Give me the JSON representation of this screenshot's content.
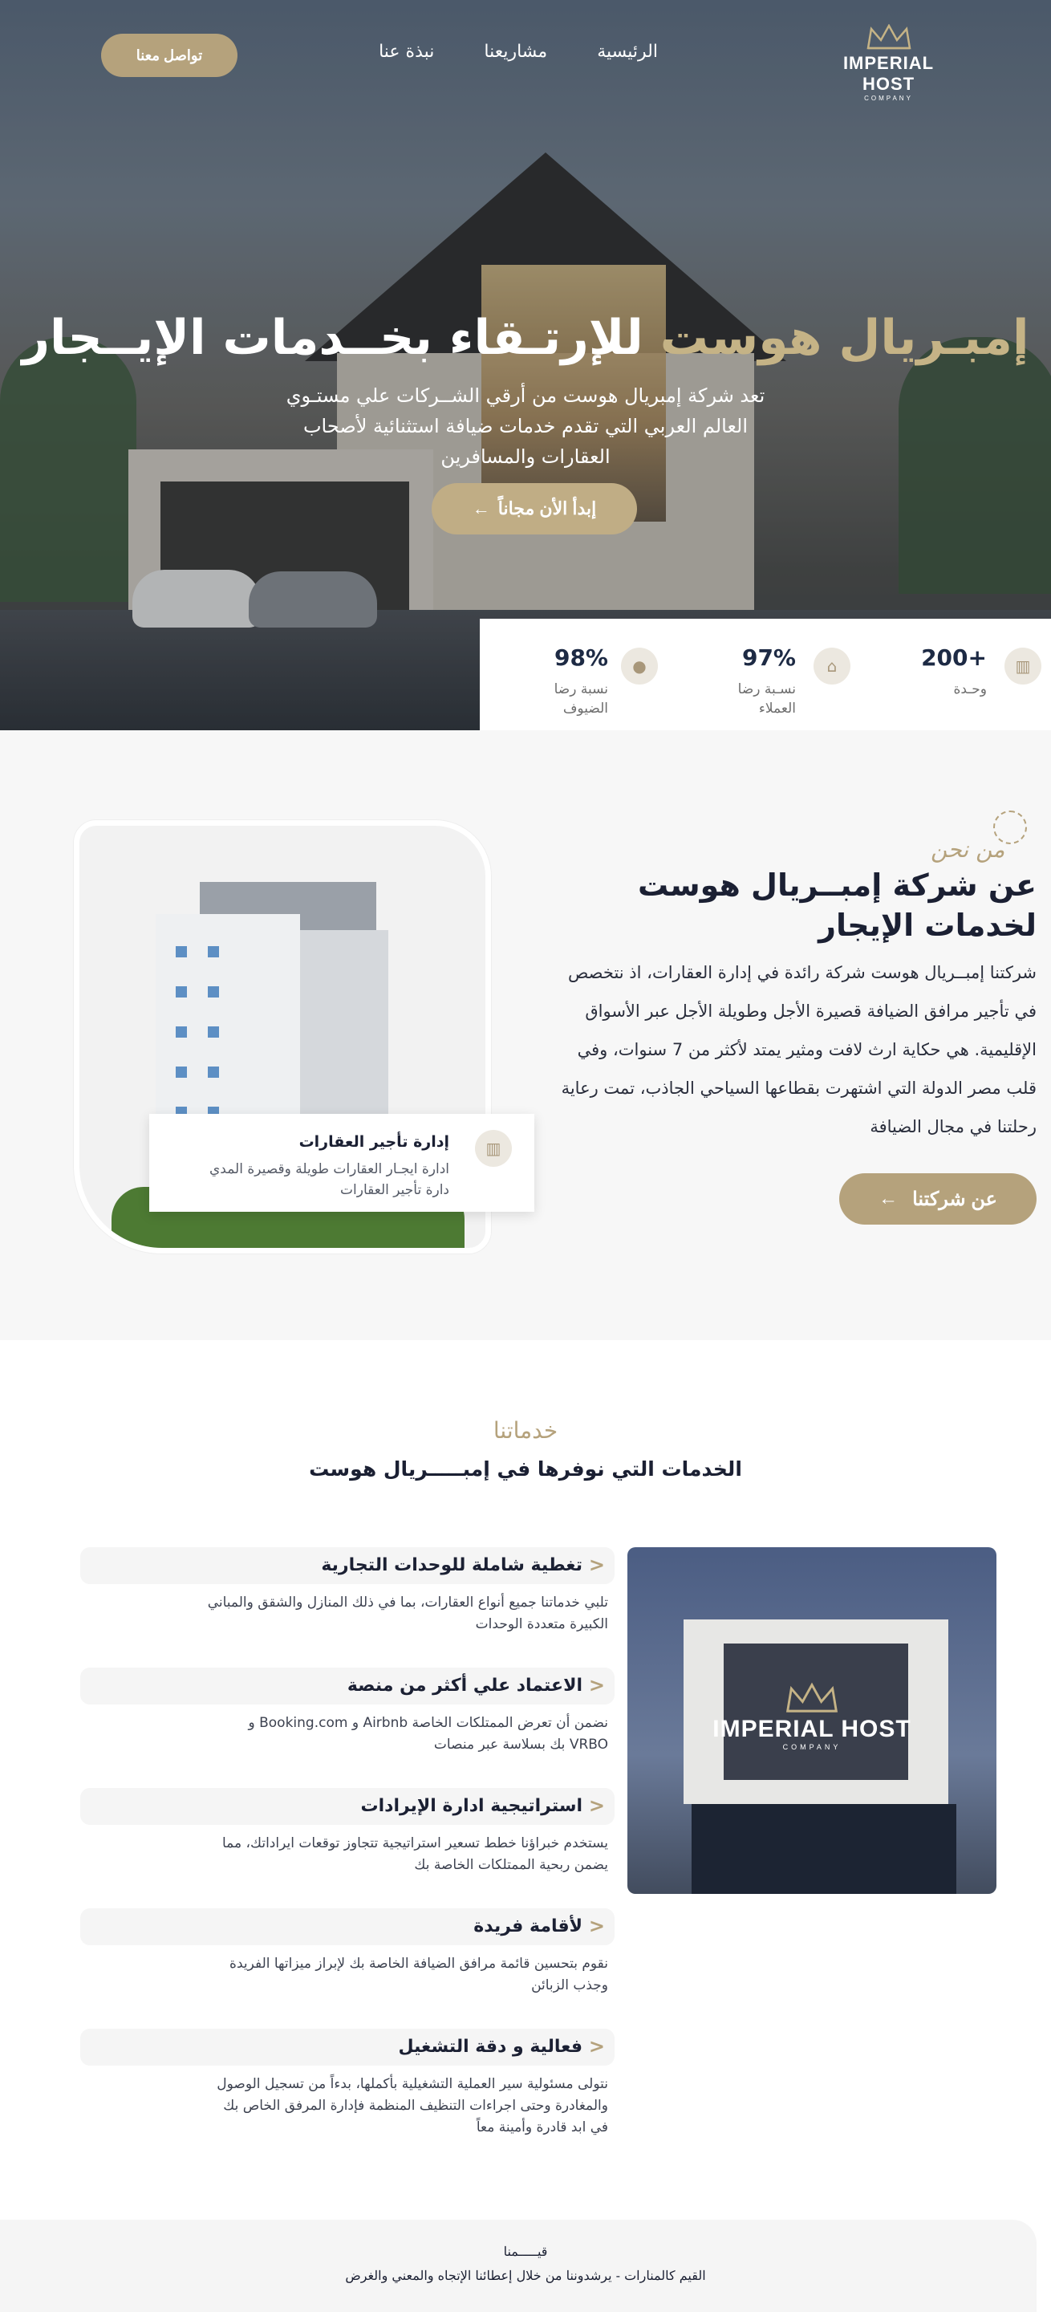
{
  "colors": {
    "gold": "#b5a27c",
    "navy": "#1b2033",
    "white": "#ffffff",
    "light_bg": "#f7f7f7"
  },
  "nav": {
    "logo": {
      "brand": "IMPERIAL HOST",
      "sub": "COMPANY",
      "icon": "crown-icon"
    },
    "links": [
      "الرئيسية",
      "مشاريعنا",
      "نبذة عنا"
    ],
    "cta": "تواصل معنا"
  },
  "hero": {
    "title_gold": "إمبـريال هوست",
    "title_white": "للإرتـقاء بخــدمات الإيــجار",
    "subtitle": "تعد شركة إمبريال هوست من أرقي الشــركات علي مستـوي العالم العربي التي تقدم خدمات ضيافة استثنائية لأصحاب العقارات والمسافرين",
    "cta": "إبدأ الأن مجاناً",
    "cta_icon": "arrow-left-icon"
  },
  "stats": [
    {
      "value": "+200",
      "label": "وحـدة",
      "icon": "building-icon"
    },
    {
      "value": "97%",
      "label": "نسـبة رضا العملاء",
      "icon": "home-icon"
    },
    {
      "value": "98%",
      "label": "نسبة رضا الضيوف",
      "icon": "user-icon"
    }
  ],
  "about": {
    "kicker": "من نحن",
    "title": "عن شركة إمبــريال هوست لخدمات الإيجار",
    "text": "شركتنا إمبــريال هوست شركة رائدة في إدارة العقارات، اذ نتخصص في تأجير مرافق الضيافة قصيرة الأجل وطويلة الأجل عبر الأسواق الإقليمية. هي حكاية ارث لافت ومثير يمتد لأكثر من 7 سنوات، وفي قلب مصر الدولة التي اشتهرت بقطاعها السياحي الجاذب، تمت رعاية رحلتنا في مجال الضيافة",
    "button": "عن شركتنا",
    "card": {
      "title": "إدارة تأجير العقارات",
      "desc": "ادارة ايجـار العقارات طويلة وقصيرة المدي دارة تأجير العقارات",
      "icon": "building-icon"
    }
  },
  "services": {
    "kicker": "خدماتنا",
    "title": "الخدمات التي نوفرها في إمبـــــريال هوست",
    "image_logo": {
      "brand": "IMPERIAL HOST",
      "sub": "COMPANY"
    },
    "items": [
      {
        "title": "تغطية شاملة للوحدات التجارية",
        "desc": "تلبي خدماتنا جميع أنواع العقارات، بما في ذلك المنازل والشقق والمباني الكبيرة متعددة الوحدات"
      },
      {
        "title": "الاعتماد علي أكثر من منصة",
        "desc": "نضمن أن تعرض الممتلكات الخاصة Airbnb و Booking.com و VRBO بك بسلاسة عبر منصات"
      },
      {
        "title": "استراتيجية ادارة الإيرادات",
        "desc": "يستخدم خبراؤنا خطط تسعير استراتيجية تتجاوز توقعات ايراداتك، مما يضمن ربحية الممتلكات الخاصة بك"
      },
      {
        "title": "لأقامة فريدة",
        "desc": "نقوم بتحسين قائمة مرافق الضيافة الخاصة بك لإبراز ميزاتها الفريدة وجذب الزبائن"
      },
      {
        "title": "فعالية و دقة التشغيل",
        "desc": "نتولى مسئولية سير العملية التشغيلية بأكملها، بدءاً من تسجيل الوصول والمغادرة وحتى اجراءات التنظيف المنظمة فإدارة المرفق الخاص بك في ابد قادرة وأمينة معاً"
      }
    ]
  },
  "values": {
    "title": "قيـــــمنا",
    "text": "القيم كالمنارات - يرشدوننا من خلال إعطائنا الإتجاه والمعني والغرض"
  }
}
